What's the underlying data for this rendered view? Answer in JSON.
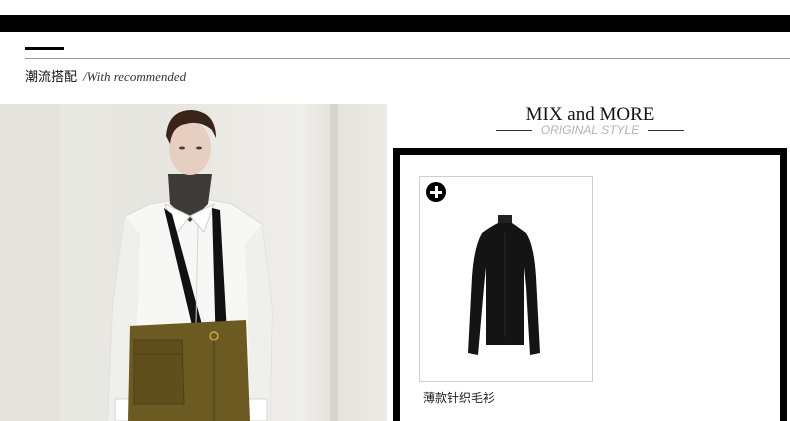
{
  "section": {
    "title_cn": "潮流搭配",
    "title_en": "/With recommended"
  },
  "mix": {
    "title": "MIX and MORE",
    "subtitle": "ORIGINAL STYLE"
  },
  "product": {
    "name": "薄款针织毛衫",
    "add_icon": "plus-circle-icon"
  },
  "colors": {
    "bar": "#000000",
    "subtitle": "#b3b3b3",
    "skirt": "#6b5a22"
  }
}
